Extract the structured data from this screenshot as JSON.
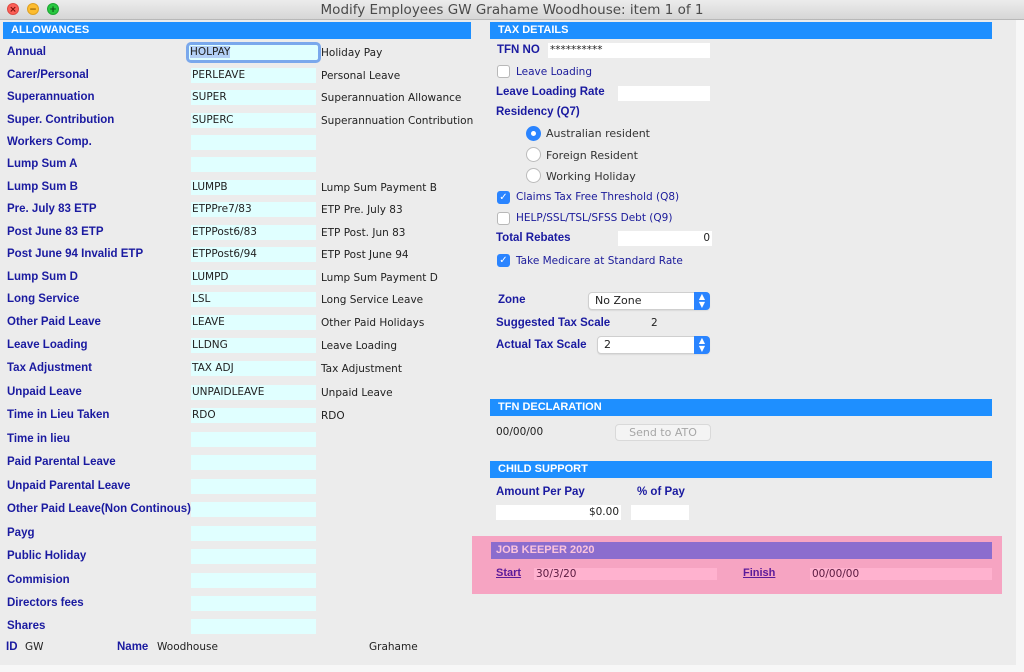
{
  "window": {
    "title": "Modify Employees GW Grahame Woodhouse: item 1  of  1"
  },
  "allowances": {
    "header": "ALLOWANCES",
    "rows": [
      {
        "label": "Annual",
        "code": "HOLPAY",
        "description": "Holiday Pay"
      },
      {
        "label": "Carer/Personal",
        "code": "PERLEAVE",
        "description": "Personal Leave"
      },
      {
        "label": "Superannuation",
        "code": "SUPER",
        "description": "Superannuation Allowance"
      },
      {
        "label": "Super. Contribution",
        "code": "SUPERC",
        "description": "Superannuation Contribution"
      },
      {
        "label": "Workers Comp.",
        "code": "",
        "description": ""
      },
      {
        "label": "Lump Sum A",
        "code": "",
        "description": ""
      },
      {
        "label": "Lump Sum B",
        "code": "LUMPB",
        "description": "Lump Sum Payment B"
      },
      {
        "label": "Pre. July 83 ETP",
        "code": "ETPPre7/83",
        "description": "ETP Pre. July 83"
      },
      {
        "label": "Post June 83 ETP",
        "code": "ETPPost6/83",
        "description": "ETP Post. Jun 83"
      },
      {
        "label": "Post June 94 Invalid ETP",
        "code": "ETPPost6/94",
        "description": "ETP Post June 94"
      },
      {
        "label": "Lump Sum D",
        "code": "LUMPD",
        "description": "Lump Sum Payment D"
      },
      {
        "label": "Long Service",
        "code": "LSL",
        "description": "Long Service Leave"
      },
      {
        "label": "Other Paid Leave",
        "code": "LEAVE",
        "description": "Other Paid Holidays"
      },
      {
        "label": "Leave Loading",
        "code": "LLDNG",
        "description": "Leave Loading"
      },
      {
        "label": "Tax Adjustment",
        "code": "TAX ADJ",
        "description": "Tax Adjustment"
      },
      {
        "label": "Unpaid Leave",
        "code": "UNPAIDLEAVE",
        "description": "Unpaid Leave"
      },
      {
        "label": "Time in Lieu Taken",
        "code": "RDO",
        "description": "RDO"
      },
      {
        "label": "Time in lieu",
        "code": "",
        "description": ""
      },
      {
        "label": "Paid Parental Leave",
        "code": "",
        "description": ""
      },
      {
        "label": "Unpaid Parental Leave",
        "code": "",
        "description": ""
      },
      {
        "label": "Other Paid Leave(Non Continous)",
        "code": "",
        "description": ""
      },
      {
        "label": "Payg",
        "code": "",
        "description": ""
      },
      {
        "label": "Public Holiday",
        "code": "",
        "description": ""
      },
      {
        "label": "Commision",
        "code": "",
        "description": ""
      },
      {
        "label": "Directors fees",
        "code": "",
        "description": ""
      },
      {
        "label": "Shares",
        "code": "",
        "description": ""
      }
    ]
  },
  "footer": {
    "id_label": "ID",
    "id_value": "GW",
    "name_label": "Name",
    "surname": "Woodhouse",
    "first_name": "Grahame"
  },
  "tax_details": {
    "header": "TAX DETAILS",
    "tfn_label": "TFN NO",
    "tfn_value": "**********",
    "leave_loading_checkbox": {
      "label": "Leave Loading",
      "checked": false
    },
    "leave_loading_rate_label": "Leave Loading Rate",
    "leave_loading_rate_value": "",
    "residency_label": "Residency (Q7)",
    "residency_options": [
      {
        "label": "Australian resident",
        "selected": true
      },
      {
        "label": "Foreign Resident",
        "selected": false
      },
      {
        "label": "Working Holiday",
        "selected": false
      }
    ],
    "tax_free_threshold": {
      "label": "Claims Tax Free Threshold (Q8)",
      "checked": true
    },
    "help_debt": {
      "label": "HELP/SSL/TSL/SFSS Debt (Q9)",
      "checked": false
    },
    "total_rebates_label": "Total Rebates",
    "total_rebates_value": "0",
    "medicare": {
      "label": "Take Medicare at Standard Rate",
      "checked": true
    },
    "zone_label": "Zone",
    "zone_value": "No Zone",
    "suggested_tax_scale_label": "Suggested Tax Scale",
    "suggested_tax_scale_value": "2",
    "actual_tax_scale_label": "Actual Tax Scale",
    "actual_tax_scale_value": "2"
  },
  "tfn_declaration": {
    "header": "TFN DECLARATION",
    "date": "00/00/00",
    "send_button": "Send to ATO"
  },
  "child_support": {
    "header": "CHILD SUPPORT",
    "amount_label": "Amount Per Pay",
    "amount_value": "$0.00",
    "percent_label": "% of Pay",
    "percent_value": ""
  },
  "job_keeper": {
    "header": "JOB KEEPER 2020",
    "start_label": "Start",
    "start_value": "30/3/20",
    "finish_label": "Finish",
    "finish_value": "00/00/00"
  },
  "icons": {
    "close": "×",
    "minimize": "−",
    "maximize": "+",
    "check": "✓",
    "select_arrows": "⌃⌄"
  },
  "colors": {
    "section_header": "#1e8fff",
    "label_text": "#1a1aa0",
    "field_bg": "#e0ffff",
    "job_keeper_panel": "#f6a4c2",
    "job_keeper_header": "#8b6dce",
    "accent": "#2a84ff"
  }
}
